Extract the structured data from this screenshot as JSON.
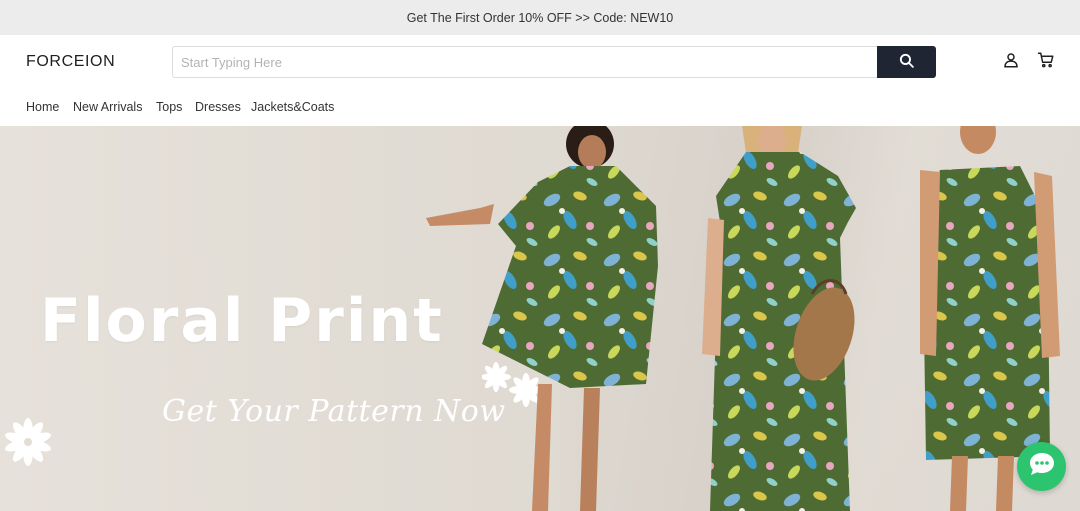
{
  "promo": {
    "text": "Get The First Order 10% OFF >> Code: NEW10"
  },
  "header": {
    "logo": "FORCEION",
    "search": {
      "placeholder": "Start Typing Here",
      "value": ""
    },
    "icons": {
      "search": "search-icon",
      "account": "user-icon",
      "cart": "cart-icon"
    }
  },
  "nav": {
    "items": [
      {
        "label": "Home"
      },
      {
        "label": "New Arrivals"
      },
      {
        "label": "Tops"
      },
      {
        "label": "Dresses"
      },
      {
        "label": "Jackets&Coats"
      }
    ]
  },
  "hero": {
    "title": "Floral Print",
    "subtitle": "Get Your Pattern Now"
  },
  "chat": {
    "icon": "chat-bubble-icon"
  },
  "colors": {
    "promo_bg": "#ececec",
    "search_button": "#1f2533",
    "chat_button": "#2cc46e",
    "hero_text": "#ffffff",
    "dress_green": "#4f6b34"
  }
}
